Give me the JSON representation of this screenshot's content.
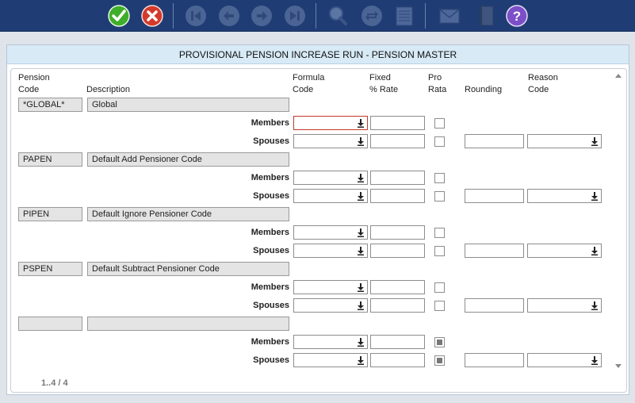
{
  "toolbar": {
    "buttons": [
      {
        "name": "accept",
        "icon": "check-icon",
        "color": "#3fae2a"
      },
      {
        "name": "cancel",
        "icon": "close-icon",
        "color": "#d33a2c"
      },
      {
        "name": "first",
        "icon": "first-record-icon"
      },
      {
        "name": "previous",
        "icon": "previous-record-icon"
      },
      {
        "name": "next",
        "icon": "next-record-icon"
      },
      {
        "name": "last",
        "icon": "last-record-icon"
      },
      {
        "name": "search",
        "icon": "magnifier-icon"
      },
      {
        "name": "refresh",
        "icon": "refresh-icon"
      },
      {
        "name": "notes",
        "icon": "notepad-icon"
      },
      {
        "name": "mail",
        "icon": "envelope-icon"
      },
      {
        "name": "book",
        "icon": "book-icon"
      },
      {
        "name": "help",
        "icon": "question-icon",
        "color": "#7b4fc8"
      }
    ]
  },
  "panel": {
    "title": "PROVISIONAL PENSION INCREASE RUN - PENSION MASTER"
  },
  "columns": {
    "pension_code": "Pension\nCode",
    "description": "Description",
    "formula_code": "Formula\nCode",
    "fixed_rate": "Fixed\n% Rate",
    "pro_rata": "Pro\nRata",
    "rounding": "Rounding",
    "reason_code": "Reason\nCode"
  },
  "row_labels": {
    "members": "Members",
    "spouses": "Spouses"
  },
  "records": [
    {
      "code": "*GLOBAL*",
      "description": "Global",
      "members_pro_rata": false,
      "spouses_pro_rata": false
    },
    {
      "code": "PAPEN",
      "description": "Default Add Pensioner Code",
      "members_pro_rata": false,
      "spouses_pro_rata": false
    },
    {
      "code": "PIPEN",
      "description": "Default Ignore Pensioner Code",
      "members_pro_rata": false,
      "spouses_pro_rata": false
    },
    {
      "code": "PSPEN",
      "description": "Default Subtract Pensioner Code",
      "members_pro_rata": false,
      "spouses_pro_rata": false
    },
    {
      "code": "",
      "description": "",
      "members_pro_rata": true,
      "spouses_pro_rata": true
    }
  ],
  "pager": {
    "text": "1..4 / 4"
  }
}
